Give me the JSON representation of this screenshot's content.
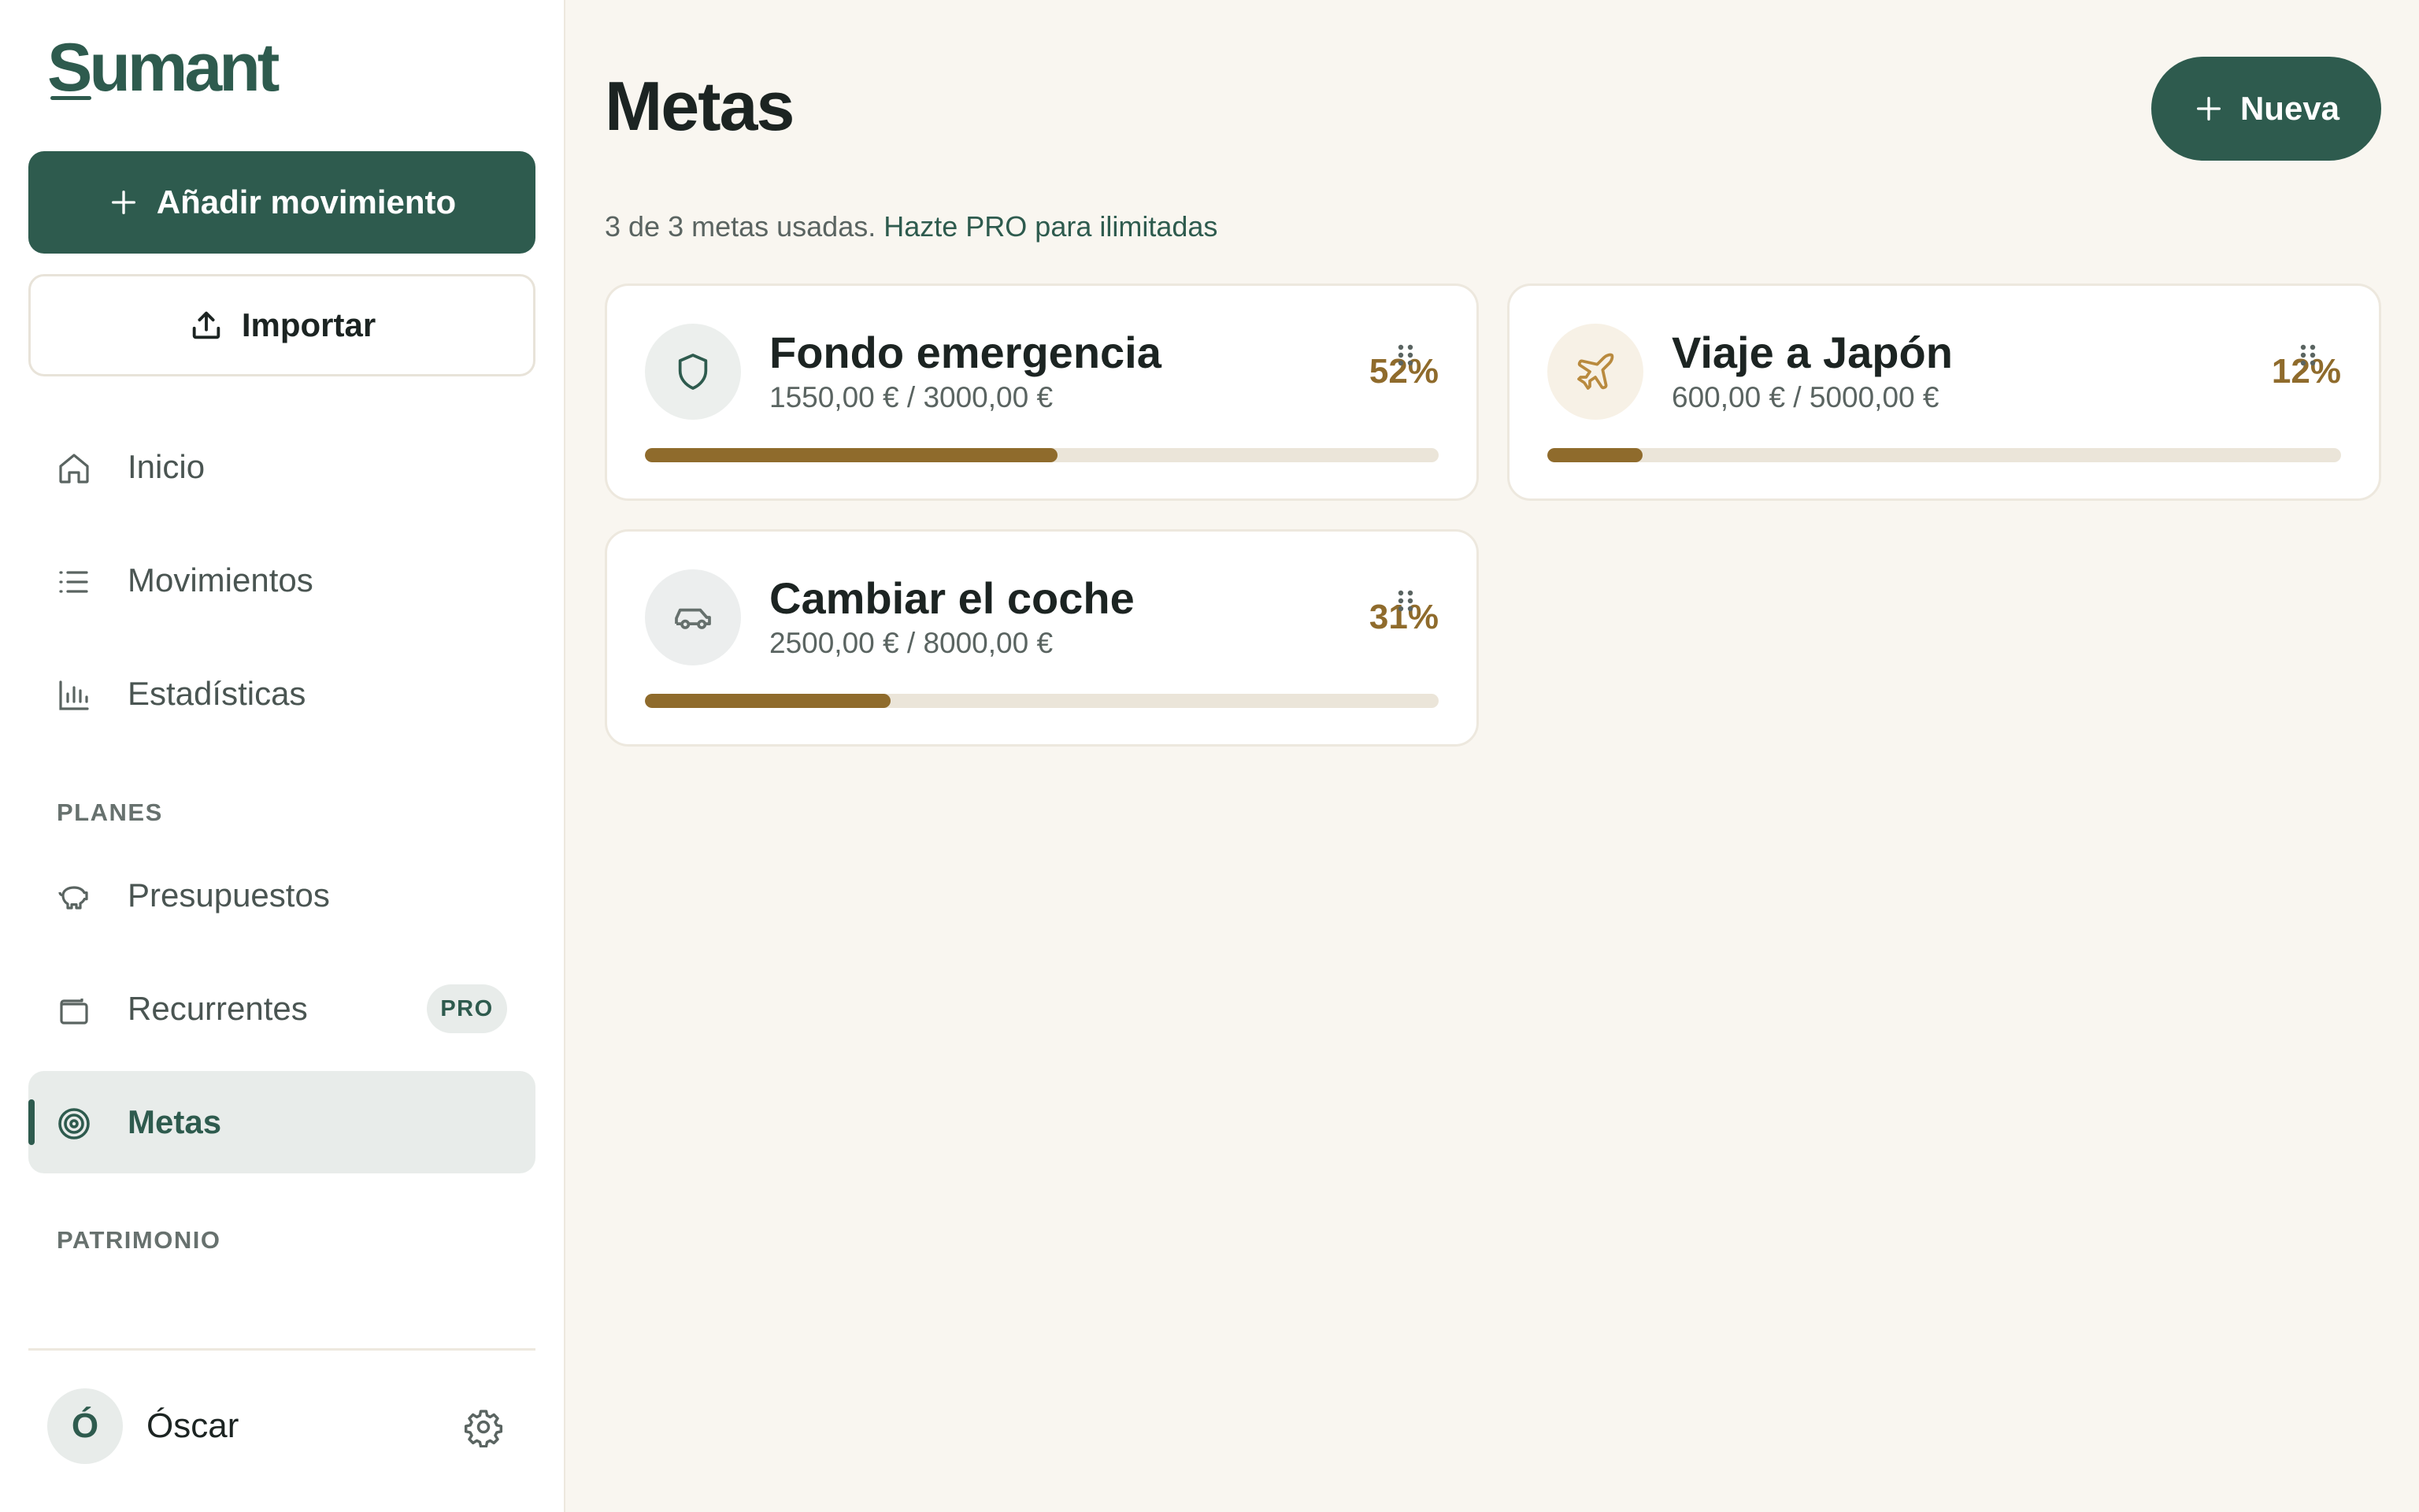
{
  "app": {
    "logo_text": "Sumant"
  },
  "sidebar": {
    "add_button_label": "Añadir movimiento",
    "import_button_label": "Importar",
    "nav": [
      {
        "label": "Inicio",
        "icon": "home-icon"
      },
      {
        "label": "Movimientos",
        "icon": "list-icon"
      },
      {
        "label": "Estadísticas",
        "icon": "bar-chart-icon"
      }
    ],
    "section_planes": "PLANES",
    "planes_items": [
      {
        "label": "Presupuestos",
        "icon": "piggy-bank-icon"
      },
      {
        "label": "Recurrentes",
        "icon": "wallet-icon",
        "badge": "PRO"
      },
      {
        "label": "Metas",
        "icon": "target-icon",
        "active": true
      }
    ],
    "section_patrimonio": "PATRIMONIO",
    "user": {
      "initial": "Ó",
      "name": "Óscar"
    }
  },
  "main": {
    "title": "Metas",
    "new_button_label": "Nueva",
    "usage_text": "3 de 3 metas usadas.",
    "upgrade_link": "Hazte PRO para ilimitadas"
  },
  "goals": [
    {
      "name": "Fondo emergencia",
      "amounts": "1550,00 € / 3000,00 €",
      "percent_label": "52%",
      "progress": 0.52,
      "icon": "shield-icon",
      "icon_bg": "#ecefed",
      "icon_color": "#2e5b4e"
    },
    {
      "name": "Viaje a Japón",
      "amounts": "600,00 € / 5000,00 €",
      "percent_label": "12%",
      "progress": 0.12,
      "icon": "plane-icon",
      "icon_bg": "#f7f1e6",
      "icon_color": "#b98a3e"
    },
    {
      "name": "Cambiar el coche",
      "amounts": "2500,00 € / 8000,00 €",
      "percent_label": "31%",
      "progress": 0.31,
      "icon": "car-icon",
      "icon_bg": "#eceeee",
      "icon_color": "#66706d"
    }
  ],
  "colors": {
    "brand": "#2e5b4e",
    "accent": "#8f6b2c",
    "background": "#f9f6f0"
  }
}
